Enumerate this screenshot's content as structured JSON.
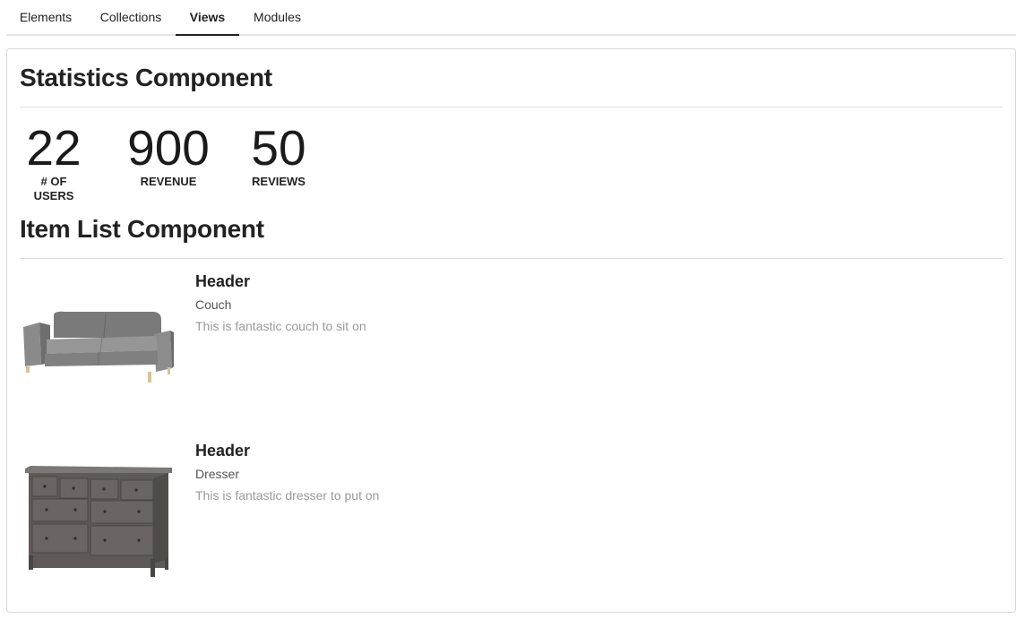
{
  "tabs": [
    {
      "label": "Elements",
      "active": false
    },
    {
      "label": "Collections",
      "active": false
    },
    {
      "label": "Views",
      "active": true
    },
    {
      "label": "Modules",
      "active": false
    }
  ],
  "statistics": {
    "title": "Statistics Component",
    "stats": [
      {
        "value": "22",
        "label": "# OF USERS"
      },
      {
        "value": "900",
        "label": "REVENUE"
      },
      {
        "value": "50",
        "label": "REVIEWS"
      }
    ]
  },
  "item_list": {
    "title": "Item List Component",
    "items": [
      {
        "header": "Header",
        "name": "Couch",
        "description": "This is fantastic couch to sit on",
        "image": "couch-image"
      },
      {
        "header": "Header",
        "name": "Dresser",
        "description": "This is fantastic dresser to put on",
        "image": "dresser-image"
      }
    ]
  }
}
